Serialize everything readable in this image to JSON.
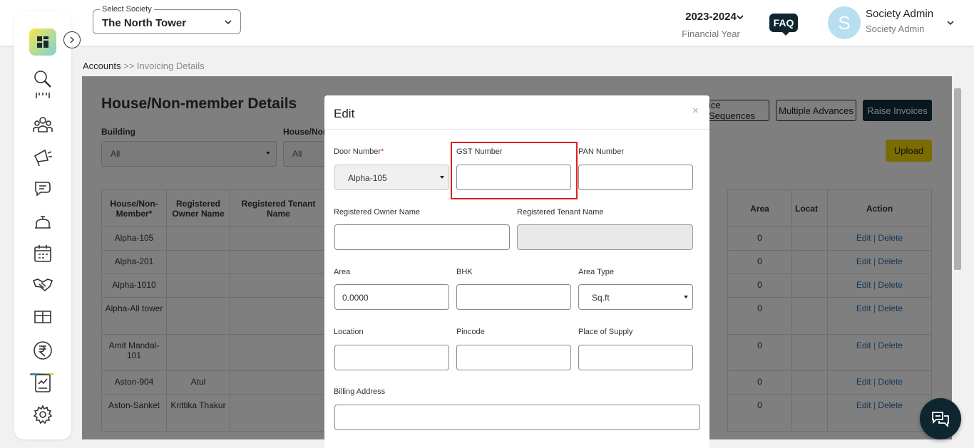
{
  "society": {
    "label": "Select Society",
    "value": "The North Tower"
  },
  "financial_year": {
    "year": "2023-2024",
    "label": "Financial Year"
  },
  "faq_label": "FAQ",
  "user": {
    "initial": "S",
    "name": "Society Admin",
    "role": "Society Admin"
  },
  "breadcrumb": {
    "root": "Accounts",
    "separator": ">>",
    "current": "Invoicing Details"
  },
  "page": {
    "title": "House/Non-member Details",
    "filters": {
      "building_label": "Building",
      "building_value": "All",
      "house_label": "House/Non",
      "house_value": "All"
    },
    "buttons": {
      "sequences": "ice Sequences",
      "multiple_advances": "Multiple Advances",
      "raise_invoices": "Raise Invoices",
      "upload": "Upload"
    },
    "table": {
      "headers": [
        "House/Non-Member*",
        "Registered Owner Name",
        "Registered Tenant Name"
      ],
      "right_headers": [
        "Area",
        "Locat",
        "Action"
      ],
      "rows": [
        {
          "house": "Alpha-105",
          "owner": "",
          "area": "0"
        },
        {
          "house": "Alpha-201",
          "owner": "",
          "area": "0"
        },
        {
          "house": "Alpha-1010",
          "owner": "",
          "area": "0"
        },
        {
          "house": "Alpha-All tower",
          "owner": "",
          "area": "0"
        },
        {
          "house": "Amit Mandal-101",
          "owner": "",
          "area": "0"
        },
        {
          "house": "Aston-904",
          "owner": "Atul",
          "area": "0"
        },
        {
          "house": "Aston-Sanket",
          "owner": "Krittika Thakur",
          "area": "0"
        }
      ],
      "edit_label": "Edit",
      "action_sep": "|",
      "delete_label": "Delete"
    }
  },
  "modal": {
    "title": "Edit",
    "close": "×",
    "fields": {
      "door_number": {
        "label": "Door Number",
        "required_mark": "*",
        "value": "Alpha-105"
      },
      "gst_number": {
        "label": "GST Number",
        "value": ""
      },
      "pan_number": {
        "label": "PAN Number",
        "value": ""
      },
      "owner_name": {
        "label": "Registered Owner Name",
        "value": ""
      },
      "tenant_name": {
        "label": "Registered Tenant Name",
        "value": ""
      },
      "area": {
        "label": "Area",
        "value": "0.0000"
      },
      "bhk": {
        "label": "BHK",
        "value": ""
      },
      "area_type": {
        "label": "Area Type",
        "value": "Sq.ft"
      },
      "location": {
        "label": "Location",
        "value": ""
      },
      "pincode": {
        "label": "Pincode",
        "value": ""
      },
      "place_of_supply": {
        "label": "Place of Supply",
        "value": ""
      },
      "billing_address": {
        "label": "Billing Address",
        "value": ""
      }
    }
  },
  "colors": {
    "brand_dark": "#0f2630",
    "accent_yellow": "#f5d800",
    "link_blue": "#2d6fb0",
    "highlight_red": "#e02020"
  }
}
